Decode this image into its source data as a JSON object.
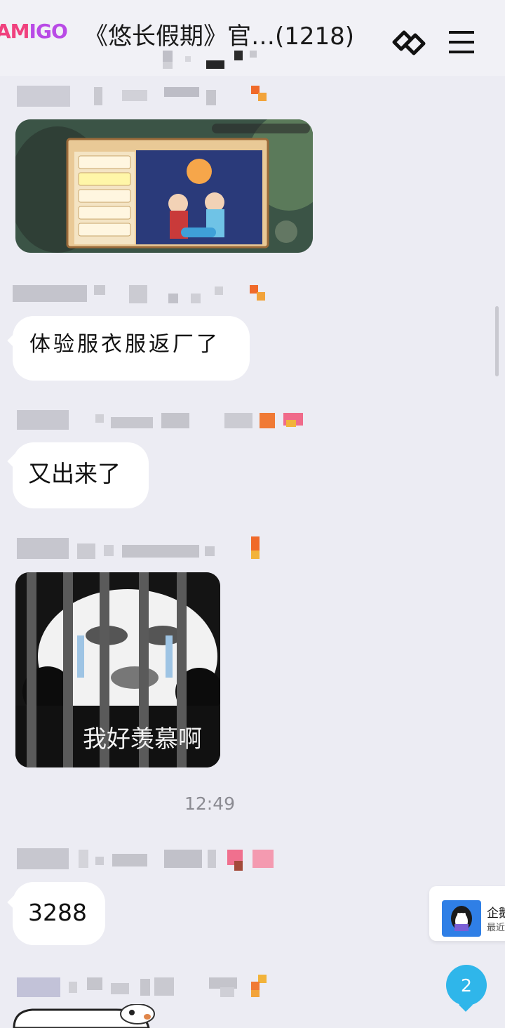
{
  "header": {
    "logo_part1": "AM",
    "logo_part2": "IGO",
    "title": "《悠长假期》官…(1218)",
    "menu_icon": "menu-icon",
    "link_icon": "link-icon"
  },
  "messages": [
    {
      "type": "image",
      "image": "game-screenshot"
    },
    {
      "type": "text",
      "text": "体验服衣服返厂了"
    },
    {
      "type": "text",
      "text": "又出来了"
    },
    {
      "type": "sticker",
      "caption": "我好羡慕啊"
    },
    {
      "type": "text",
      "text": "3288"
    }
  ],
  "timestamp": "12:49",
  "promo": {
    "line1": "企鹅",
    "line2": "最近",
    "icon": "penguin-icon"
  },
  "unread_count": "2",
  "colors": {
    "background": "#ececf3",
    "bubble": "#ffffff",
    "badge": "#2fb6ea",
    "logo_pink": "#f0417e",
    "logo_purple": "#b94be6"
  }
}
